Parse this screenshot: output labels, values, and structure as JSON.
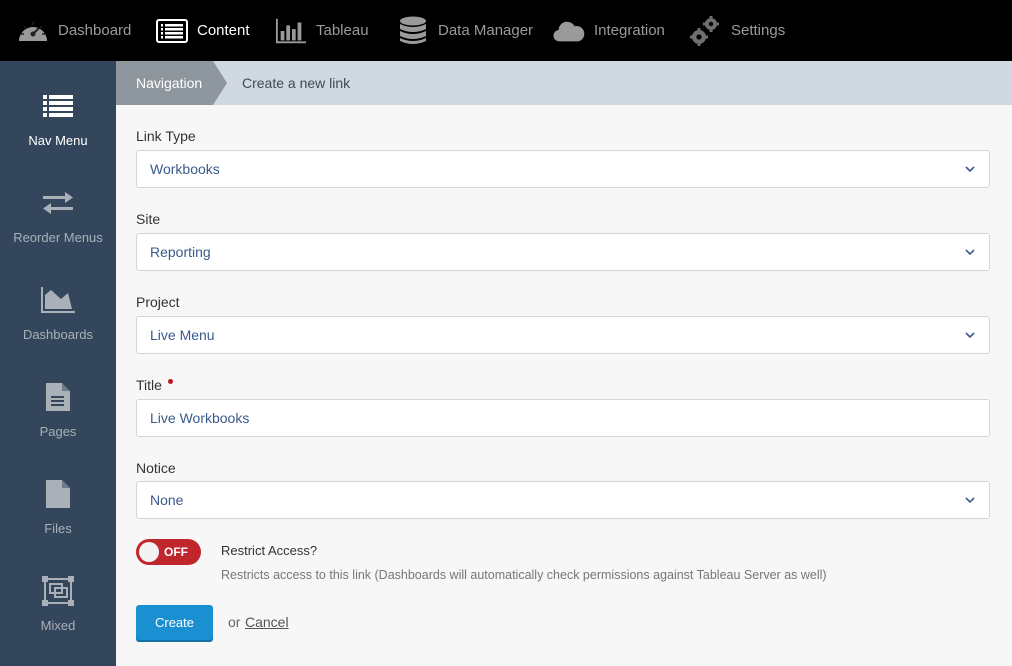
{
  "topnav": {
    "items": [
      {
        "label": "Dashboard",
        "icon": "speedometer-icon",
        "active": false
      },
      {
        "label": "Content",
        "icon": "list-icon",
        "active": true
      },
      {
        "label": "Tableau",
        "icon": "bar-chart-icon",
        "active": false
      },
      {
        "label": "Data Manager",
        "icon": "database-icon",
        "active": false
      },
      {
        "label": "Integration",
        "icon": "cloud-icon",
        "active": false
      },
      {
        "label": "Settings",
        "icon": "gears-icon",
        "active": false
      }
    ]
  },
  "sidebar": {
    "items": [
      {
        "label": "Nav Menu",
        "icon": "list-icon",
        "active": true
      },
      {
        "label": "Reorder Menus",
        "icon": "swap-arrows-icon",
        "active": false
      },
      {
        "label": "Dashboards",
        "icon": "area-chart-icon",
        "active": false
      },
      {
        "label": "Pages",
        "icon": "document-icon",
        "active": false
      },
      {
        "label": "Files",
        "icon": "file-icon",
        "active": false
      },
      {
        "label": "Mixed",
        "icon": "object-group-icon",
        "active": false
      }
    ]
  },
  "breadcrumb": {
    "parent": "Navigation",
    "current": "Create a new link"
  },
  "form": {
    "link_type": {
      "label": "Link Type",
      "value": "Workbooks"
    },
    "site": {
      "label": "Site",
      "value": "Reporting"
    },
    "project": {
      "label": "Project",
      "value": "Live Menu"
    },
    "title": {
      "label": "Title",
      "value": "Live Workbooks",
      "required": true
    },
    "notice": {
      "label": "Notice",
      "value": "None"
    },
    "restrict": {
      "toggle_state": "OFF",
      "label": "Restrict Access?",
      "description": "Restricts access to this link (Dashboards will automatically check permissions against Tableau Server as well)"
    },
    "create_label": "Create",
    "or_text": "or",
    "cancel_label": "Cancel"
  },
  "colors": {
    "topbar_bg": "#000000",
    "sidebar_bg": "#34465b",
    "breadcrumb_bg": "#d1d9e0",
    "breadcrumb_active_bg": "#8e969e",
    "toggle_off": "#c0272d",
    "primary_button": "#1a8fd2",
    "select_text": "#3a5a8c",
    "required_dot": "#c0171c"
  }
}
